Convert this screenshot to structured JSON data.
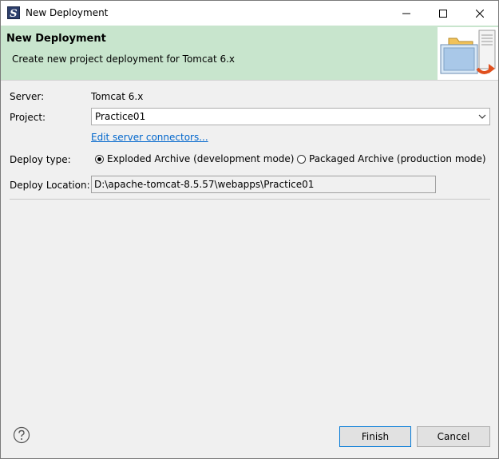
{
  "window": {
    "title": "New Deployment",
    "icon": "eclipse-s-icon"
  },
  "banner": {
    "title": "New Deployment",
    "description": "Create new project deployment for Tomcat  6.x",
    "image": "deployment-folder-icon",
    "background": "#c8e5cd"
  },
  "form": {
    "server_label": "Server:",
    "server_value": "Tomcat  6.x",
    "project_label": "Project:",
    "project_value": "Practice01",
    "edit_link": "Edit server connectors...",
    "deploy_type_label": "Deploy type:",
    "radio_exploded": "Exploded Archive (development mode)",
    "radio_packaged": "Packaged Archive (production mode)",
    "selected_deploy_type": "exploded",
    "deploy_location_label": "Deploy Location:",
    "deploy_location_value": "D:\\apache-tomcat-8.5.57\\webapps\\Practice01"
  },
  "buttons": {
    "finish": "Finish",
    "cancel": "Cancel"
  },
  "colors": {
    "link": "#0066cc",
    "default_button_border": "#0078d7"
  }
}
